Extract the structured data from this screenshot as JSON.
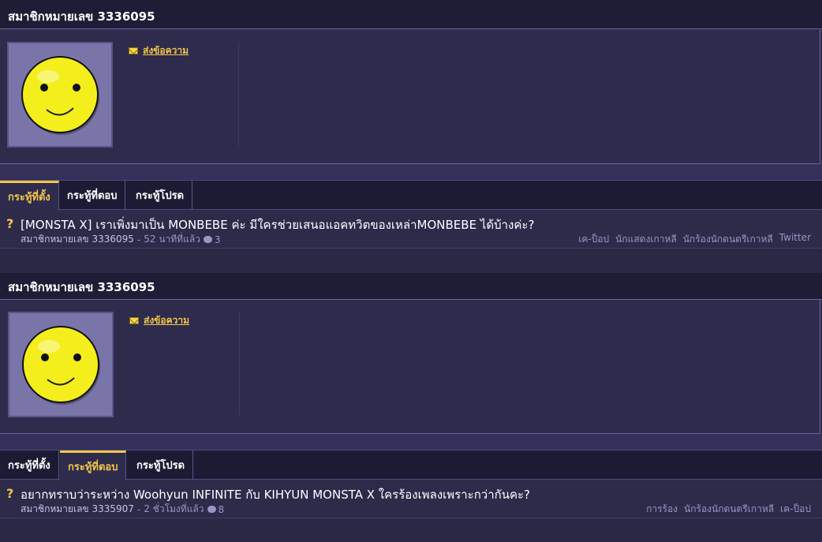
{
  "members": [
    {
      "title": "สมาชิกหมายเลข 3336095",
      "send_message_label": "ส่งข้อความ",
      "tabs": [
        "กระทู้ที่ตั้ง",
        "กระทู้ที่ตอบ",
        "กระทู้โปรด"
      ],
      "active_tab": 0,
      "topic": {
        "title": "[MONSTA X] เราเพิ่งมาเป็น MONBEBE ค่ะ มีใครช่วยเสนอแอคทวิตของเหล่าMONBEBE ได้บ้างค่ะ?",
        "author": "สมาชิกหมายเลข 3336095",
        "time": "52 นาทีที่แล้ว",
        "comments": "3",
        "tags": [
          "เค-ป็อป",
          "นักแสดงเกาหลี",
          "นักร้องนักดนตรีเกาหลี",
          "Twitter"
        ]
      }
    },
    {
      "title": "สมาชิกหมายเลข 3336095",
      "send_message_label": "ส่งข้อความ",
      "tabs": [
        "กระทู้ที่ตั้ง",
        "กระทู้ที่ตอบ",
        "กระทู้โปรด"
      ],
      "active_tab": 1,
      "topic": {
        "title": "อยากทราบว่าระหว่าง Woohyun INFINITE กับ KIHYUN MONSTA X ใครร้องเพลงเพราะกว่ากันคะ?",
        "author": "สมาชิกหมายเลข 3335907",
        "time": "2 ชั่วโมงที่แล้ว",
        "comments": "8",
        "tags": [
          "การร้อง",
          "นักร้องนักดนตรีเกาหลี",
          "เค-ป็อป"
        ]
      }
    }
  ],
  "colors": {
    "accent": "#f3c74a",
    "background": "#2d2a4a",
    "header": "#1f1d36"
  }
}
